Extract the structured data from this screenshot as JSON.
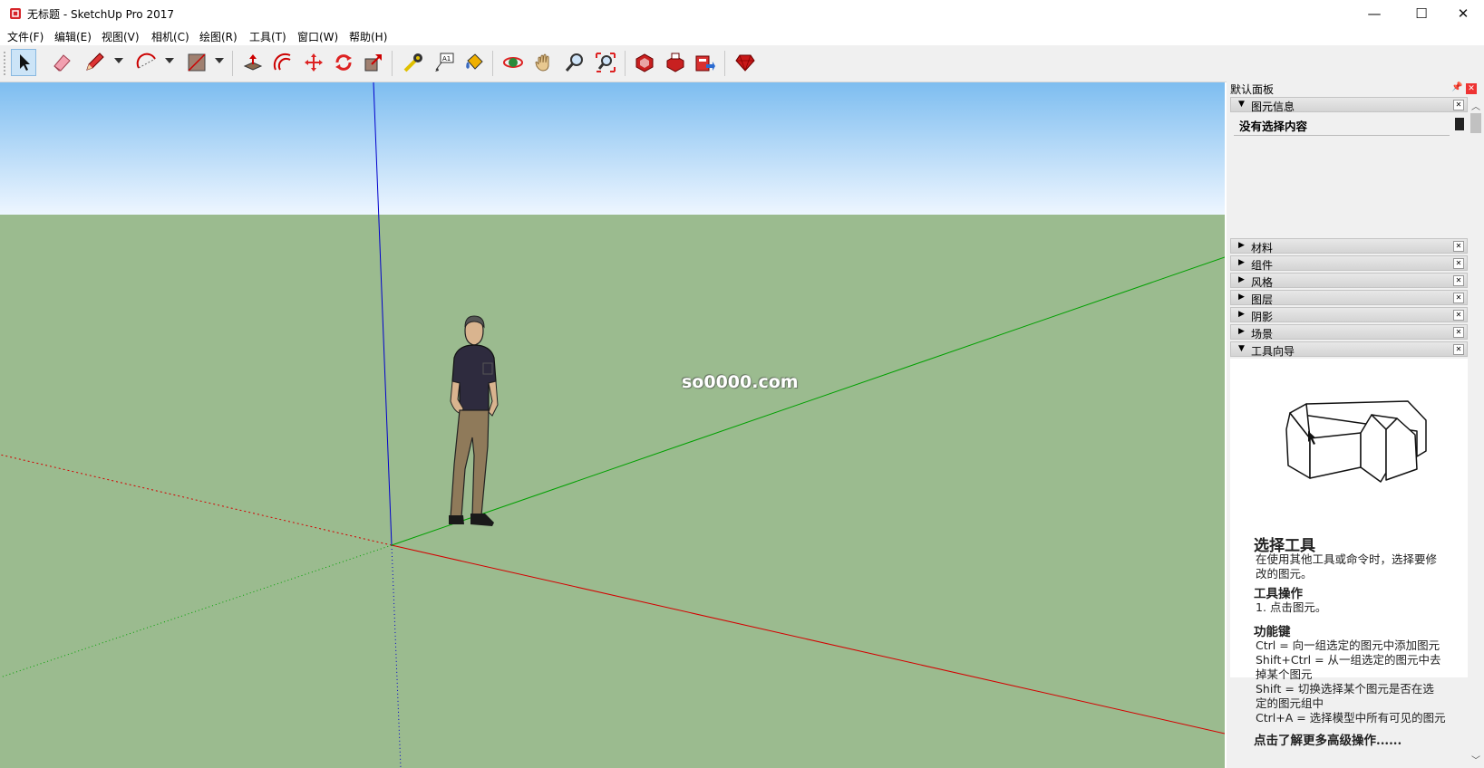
{
  "window": {
    "title": "无标题 - SketchUp Pro 2017",
    "controls": {
      "minimize": "—",
      "maximize": "☐",
      "close": "✕"
    }
  },
  "menu": {
    "items": [
      "文件(F)",
      "编辑(E)",
      "视图(V)",
      "相机(C)",
      "绘图(R)",
      "工具(T)",
      "窗口(W)",
      "帮助(H)"
    ]
  },
  "toolbar": {
    "tools": [
      "select-tool",
      "eraser-tool",
      "pencil-tool",
      "arc-tool",
      "rectangle-tool",
      "push-pull-tool",
      "offset-tool",
      "move-tool",
      "rotate-tool",
      "scale-tool",
      "tape-measure-tool",
      "text-tool",
      "paint-bucket-tool",
      "orbit-tool",
      "pan-tool",
      "zoom-tool",
      "zoom-extents-tool",
      "warehouse-tool",
      "extension-warehouse-tool",
      "send-to-layout-tool",
      "ruby-tool"
    ]
  },
  "viewport": {
    "watermark": "so0000.com",
    "colors": {
      "sky_top": "#7dbdf0",
      "ground": "#9bbb8f",
      "red_axis": "#d40000",
      "green_axis": "#00a000",
      "blue_axis": "#0000cc"
    }
  },
  "tray": {
    "title": "默认面板",
    "entity_info": {
      "label": "图元信息",
      "no_selection": "没有选择内容"
    },
    "panels": [
      "材料",
      "组件",
      "风格",
      "图层",
      "阴影",
      "场景"
    ],
    "instructor": {
      "label": "工具向导",
      "tool_title": "选择工具",
      "description": "在使用其他工具或命令时，选择要修改的图元。",
      "ops_heading": "工具操作",
      "ops_steps": [
        "1. 点击图元。"
      ],
      "keys_heading": "功能键",
      "keys": [
        "Ctrl = 向一组选定的图元中添加图元",
        "Shift+Ctrl = 从一组选定的图元中去",
        "掉某个图元",
        "Shift = 切换选择某个图元是否在选",
        "定的图元组中",
        "Ctrl+A = 选择模型中所有可见的图元"
      ],
      "more_link": "点击了解更多高级操作......"
    }
  }
}
